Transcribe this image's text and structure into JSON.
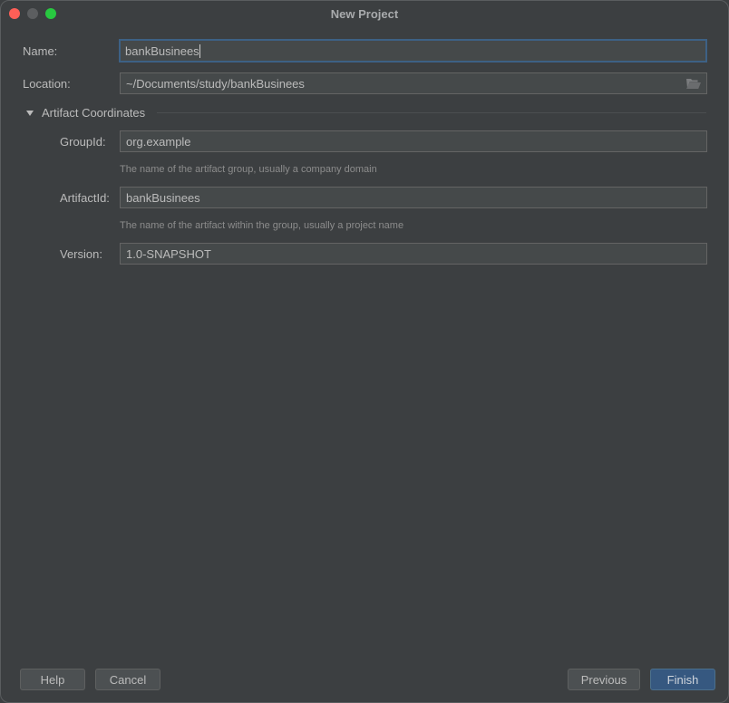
{
  "window": {
    "title": "New Project",
    "traffic_lights": [
      "close",
      "minimize",
      "zoom"
    ]
  },
  "form": {
    "name": {
      "label": "Name:",
      "value": "bankBusinees"
    },
    "location": {
      "label": "Location:",
      "value": "~/Documents/study/bankBusinees",
      "browse_icon": "folder-icon"
    },
    "section": {
      "title": "Artifact Coordinates",
      "expanded": true
    },
    "group_id": {
      "label": "GroupId:",
      "value": "org.example",
      "hint": "The name of the artifact group, usually a company domain"
    },
    "artifact_id": {
      "label": "ArtifactId:",
      "value": "bankBusinees",
      "hint": "The name of the artifact within the group, usually a project name"
    },
    "version": {
      "label": "Version:",
      "value": "1.0-SNAPSHOT"
    }
  },
  "buttons": {
    "help": "Help",
    "cancel": "Cancel",
    "previous": "Previous",
    "finish": "Finish"
  },
  "colors": {
    "background": "#3c3f41",
    "field_bg": "#45494a",
    "focus_border": "#3d6185",
    "primary_button": "#365880"
  }
}
